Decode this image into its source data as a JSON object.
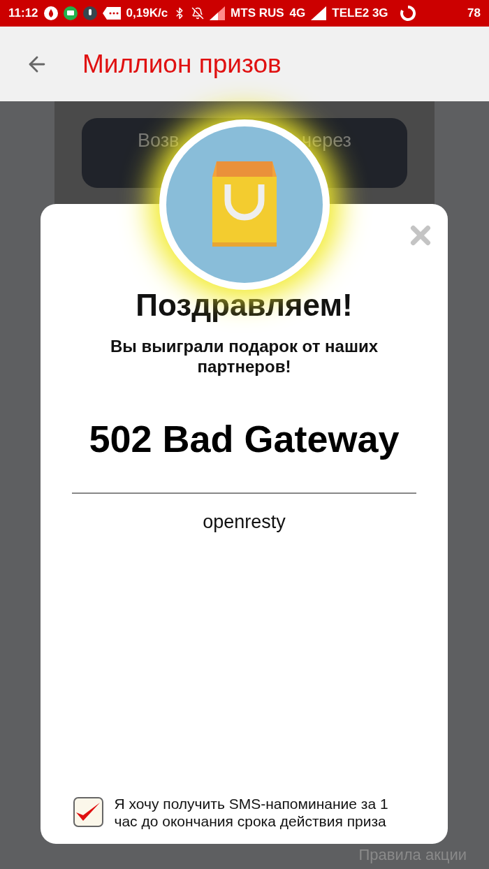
{
  "status_bar": {
    "time": "11:12",
    "speed": "0,19K/c",
    "carrier_1": "MTS RUS",
    "network_1": "4G",
    "carrier_2": "TELE2 3G",
    "battery": "78"
  },
  "app_bar": {
    "title": "Миллион призов"
  },
  "background": {
    "button_left": "Возв",
    "button_right": "через",
    "footer_link": "Правила акции"
  },
  "dialog": {
    "title": "Поздравляем!",
    "subtitle": "Вы выиграли подарок от наших партнеров!",
    "error_heading": "502 Bad Gateway",
    "server": "openresty",
    "sms_option": {
      "label": "Я хочу получить SMS-напоминание за 1 час до окончания срока действия приза",
      "checked": true
    }
  }
}
